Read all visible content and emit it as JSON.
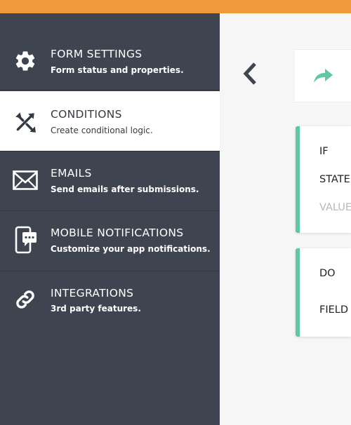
{
  "sidebar": {
    "items": [
      {
        "id": "form-settings",
        "title": "FORM SETTINGS",
        "description": "Form status and properties.",
        "icon": "gear-icon",
        "active": false
      },
      {
        "id": "conditions",
        "title": "CONDITIONS",
        "description": "Create conditional logic.",
        "icon": "conditions-icon",
        "active": true
      },
      {
        "id": "emails",
        "title": "EMAILS",
        "description": "Send emails after submissions.",
        "icon": "envelope-icon",
        "active": false
      },
      {
        "id": "mobile-notifications",
        "title": "MOBILE NOTIFICATIONS",
        "description": "Customize your app notifications.",
        "icon": "mobile-chat-icon",
        "active": false
      },
      {
        "id": "integrations",
        "title": "INTEGRATIONS",
        "description": "3rd party features.",
        "icon": "link-icon",
        "active": false
      }
    ]
  },
  "toolbar": {
    "back_icon": "chevron-left-icon",
    "redo_icon": "redo-arrow-icon"
  },
  "conditions": {
    "if_card": {
      "if_label": "IF",
      "state_label": "STATE",
      "value_label": "VALUE"
    },
    "do_card": {
      "do_label": "DO",
      "field_label": "FIELD"
    }
  },
  "colors": {
    "topbar": "#ef9a3a",
    "sidebar": "#3f4550",
    "accent": "#5ec8a5",
    "redo_icon": "#5ec8a5"
  }
}
